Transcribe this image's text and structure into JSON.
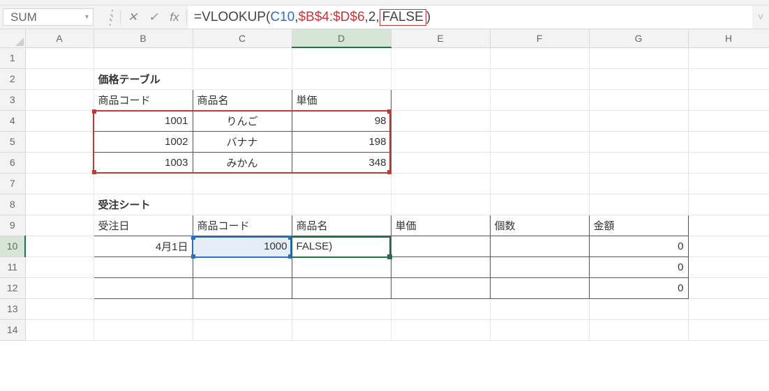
{
  "namebox": {
    "value": "SUM"
  },
  "formula_bar": {
    "eq": "=",
    "fn": "VLOOKUP",
    "open": "(",
    "ref1": "C10",
    "comma1": ",",
    "ref2": "$B$4:$D$6",
    "comma2": ",",
    "arg3": "2",
    "comma3": ",",
    "arg4": "FALSE",
    "close": ")"
  },
  "columns": [
    "",
    "A",
    "B",
    "C",
    "D",
    "E",
    "F",
    "G",
    "H"
  ],
  "rows": [
    "1",
    "2",
    "3",
    "4",
    "5",
    "6",
    "7",
    "8",
    "9",
    "10",
    "11",
    "12",
    "13",
    "14"
  ],
  "content": {
    "B2": "価格テーブル",
    "B3": "商品コード",
    "C3": "商品名",
    "D3": "単価",
    "B4": "1001",
    "C4": "りんご",
    "D4": "98",
    "B5": "1002",
    "C5": "バナナ",
    "D5": "198",
    "B6": "1003",
    "C6": "みかん",
    "D6": "348",
    "B8": "受注シート",
    "B9": "受注日",
    "C9": "商品コード",
    "D9": "商品名",
    "E9": "単価",
    "F9": "個数",
    "G9": "金額",
    "B10": "4月1日",
    "C10": "1000",
    "D10": "FALSE)",
    "G10": "0",
    "G11": "0",
    "G12": "0"
  },
  "icons": {
    "cancel": "✕",
    "enter": "✓",
    "fx": "fx",
    "dropdown": "▾",
    "expand": "˅"
  }
}
